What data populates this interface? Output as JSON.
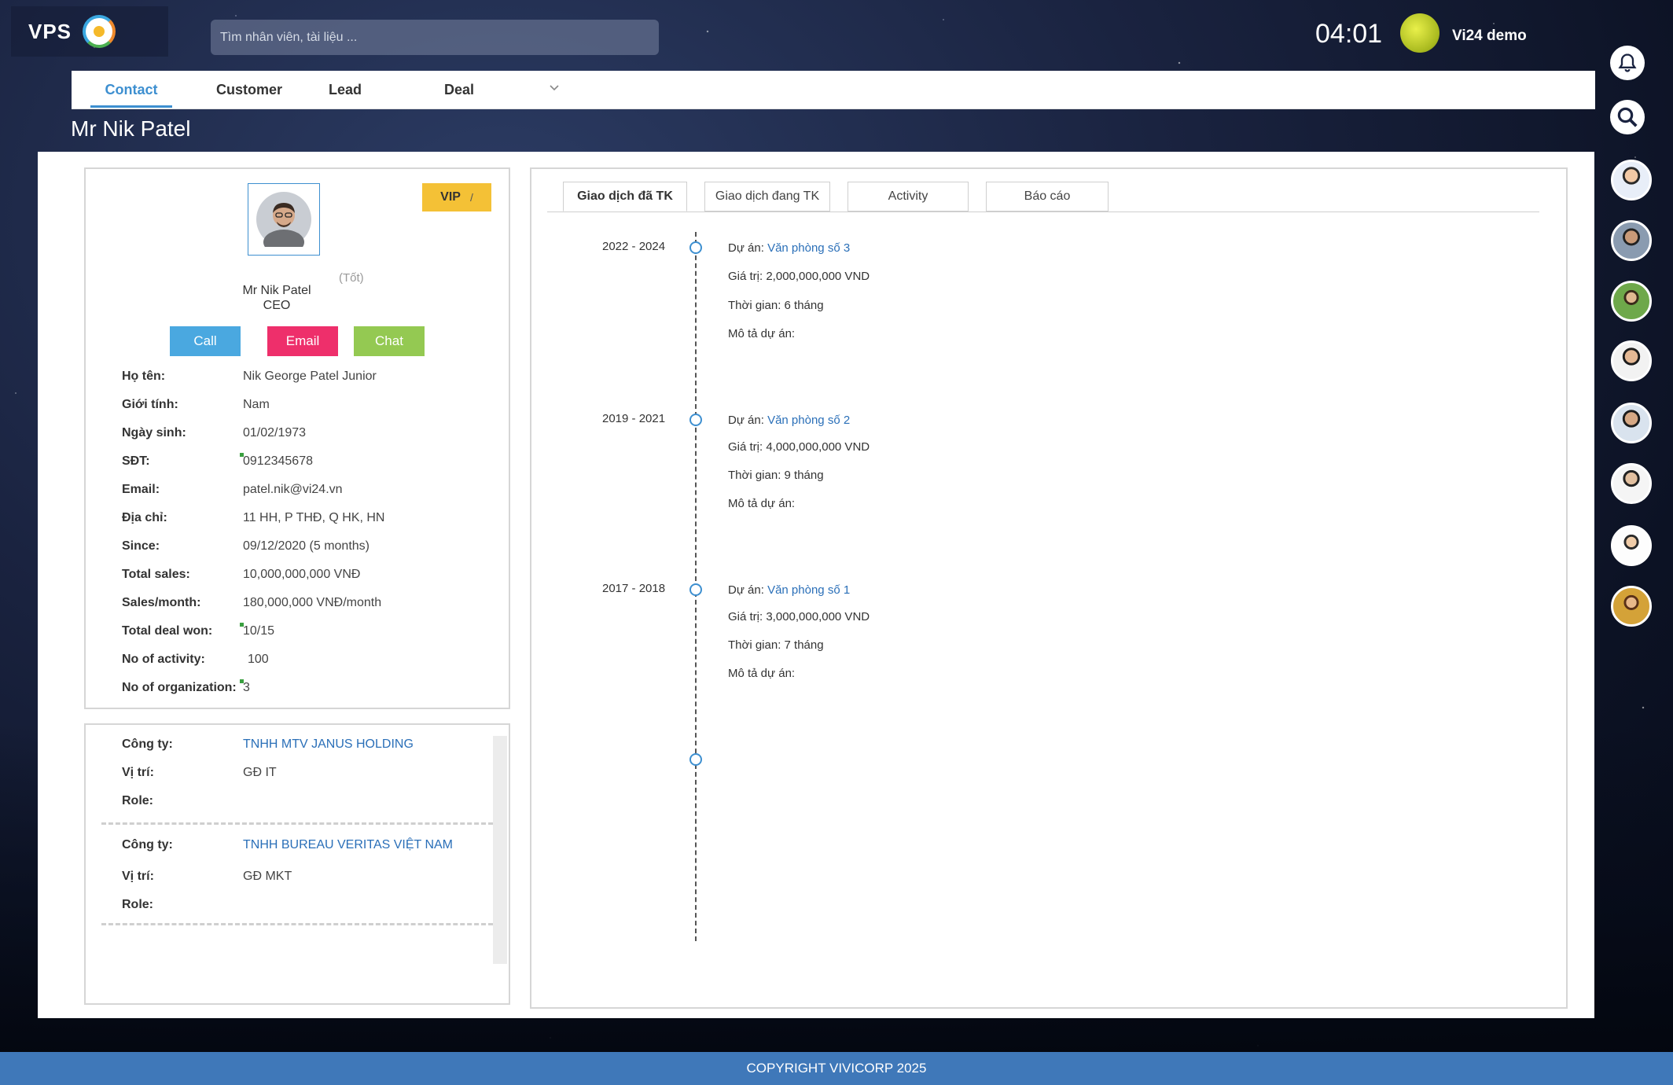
{
  "app": {
    "logo_text": "VPS",
    "clock": "04:01",
    "user_name": "Vi24 demo"
  },
  "search": {
    "placeholder": "Tìm nhân viên, tài liệu ..."
  },
  "nav": {
    "tabs": [
      {
        "label": "Contact",
        "active": true
      },
      {
        "label": "Customer"
      },
      {
        "label": "Lead"
      },
      {
        "label": "Deal"
      }
    ]
  },
  "page": {
    "title": "Mr Nik Patel"
  },
  "profile": {
    "badge": "VIP",
    "rating": "(Tốt)",
    "name": "Mr Nik Patel",
    "title": "CEO",
    "actions": {
      "call": "Call",
      "email": "Email",
      "chat": "Chat"
    },
    "fields": [
      {
        "label": "Họ tên:",
        "value": "Nik George Patel Junior"
      },
      {
        "label": "Giới tính:",
        "value": "Nam"
      },
      {
        "label": "Ngày sinh:",
        "value": "01/02/1973"
      },
      {
        "label": "SĐT:",
        "value": "0912345678"
      },
      {
        "label": "Email:",
        "value": "patel.nik@vi24.vn"
      },
      {
        "label": "Địa chỉ:",
        "value": "11 HH, P THĐ, Q HK, HN"
      },
      {
        "label": "Since:",
        "value": "09/12/2020 (5 months)"
      },
      {
        "label": "Total sales:",
        "value": "10,000,000,000 VNĐ"
      },
      {
        "label": "Sales/month:",
        "value": "180,000,000 VNĐ/month"
      },
      {
        "label": "Total deal won:",
        "value": "10/15"
      },
      {
        "label": "No of activity:",
        "value": "100"
      },
      {
        "label": "No of organization:",
        "value": "3"
      }
    ]
  },
  "organizations": [
    {
      "company_label": "Công ty:",
      "company": "TNHH MTV JANUS HOLDING",
      "position_label": "Vị trí:",
      "position": "GĐ IT",
      "role_label": "Role:",
      "role": ""
    },
    {
      "company_label": "Công ty:",
      "company": "TNHH BUREAU VERITAS VIỆT NAM",
      "position_label": "Vị trí:",
      "position": "GĐ MKT",
      "role_label": "Role:",
      "role": ""
    }
  ],
  "detail_tabs": [
    {
      "label": "Giao dịch đã TK",
      "active": true
    },
    {
      "label": "Giao dịch đang TK"
    },
    {
      "label": "Activity"
    },
    {
      "label": "Báo cáo"
    }
  ],
  "timeline": [
    {
      "period": "2022 - 2024",
      "project_label": "Dự án:",
      "project": "Văn phòng số 3",
      "value": "Giá trị: 2,000,000,000 VND",
      "duration": "Thời gian: 6 tháng",
      "description": "Mô tả dự án:"
    },
    {
      "period": "2019 - 2021",
      "project_label": "Dự án:",
      "project": "Văn phòng số 2",
      "value": "Giá trị: 4,000,000,000 VND",
      "duration": "Thời gian: 9 tháng",
      "description": "Mô tả dự án:"
    },
    {
      "period": "2017 - 2018",
      "project_label": "Dự án:",
      "project": "Văn phòng số 1",
      "value": "Giá trị: 3,000,000,000 VND",
      "duration": "Thời gian: 7 tháng",
      "description": "Mô tả dự án:"
    }
  ],
  "footer": {
    "text": "COPYRIGHT VIVICORP 2025"
  },
  "colors": {
    "accent": "#3d8fd0",
    "call": "#4aa8e0",
    "email": "#ee2f6b",
    "chat": "#94c952",
    "vip": "#f4c136",
    "footer": "#3f78b9"
  }
}
